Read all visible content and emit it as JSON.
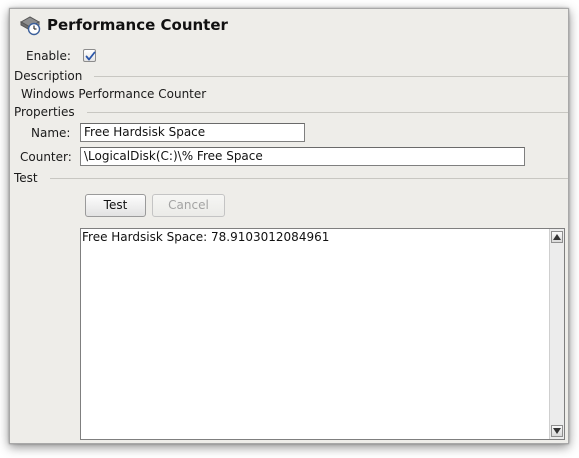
{
  "window": {
    "title": "Performance Counter",
    "title_icon": "performance-counter-icon"
  },
  "enable": {
    "label": "Enable:",
    "checked": true
  },
  "description": {
    "section_label": "Description",
    "value": "Windows Performance Counter"
  },
  "properties": {
    "section_label": "Properties",
    "name_label": "Name:",
    "name_value": "Free Hardsisk Space",
    "counter_label": "Counter:",
    "counter_value": "\\LogicalDisk(C:)\\% Free Space"
  },
  "test": {
    "section_label": "Test",
    "test_button": "Test",
    "cancel_button": "Cancel",
    "output": "Free Hardsisk Space: 78.9103012084961"
  },
  "colors": {
    "panel_bg": "#eeede9",
    "border": "#7f7f7f",
    "disabled_text": "#a3a3a3"
  }
}
